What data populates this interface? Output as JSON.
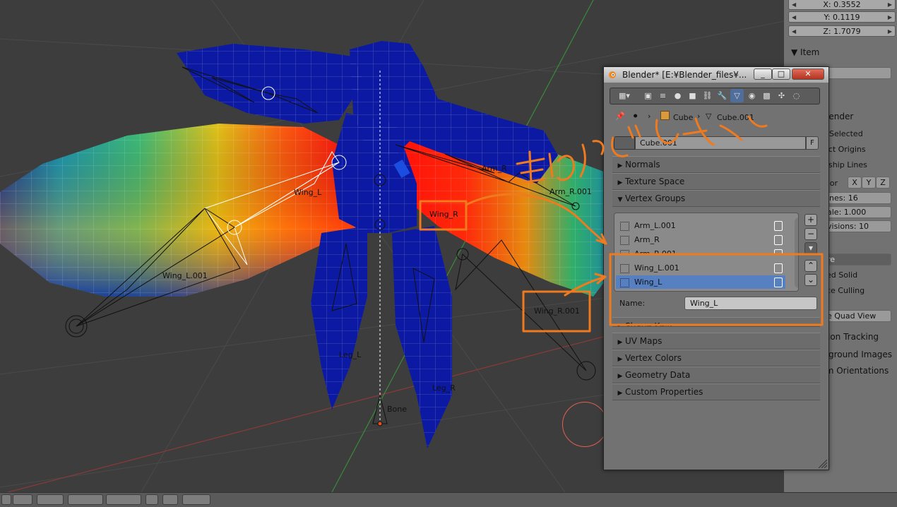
{
  "viewport": {
    "bone_labels": [
      "Wing_L",
      "Wing_L.001",
      "Wing_R",
      "Wing_R.001",
      "Arm_R",
      "Arm_R.001",
      "Bone",
      "Leg_L",
      "Leg_R"
    ]
  },
  "npanel": {
    "location": {
      "x": "X: 0.3552",
      "y": "Y: 0.1119",
      "z": "Z: 1.7079"
    },
    "item_header": "Item",
    "partial_rows": {
      "item_field": "e",
      "blender": "lender",
      "only_selected": "Selected",
      "object_origins": "ect Origins",
      "relationship_lines": "nship Lines",
      "floor": "oor",
      "axis_x": "X",
      "axis_y": "Y",
      "axis_z": "Z",
      "lines": "ines: 16",
      "scale": "ale: 1.000",
      "subdivisions": "visions: 10",
      "shading_select": "re",
      "textured_solid": "ed Solid",
      "backface_culling": "ce Culling",
      "quad_view": "e Quad View",
      "motion_tracking": "ion Tracking",
      "background_images": "kground Images",
      "transform_orientations": "rm Orientations"
    }
  },
  "window": {
    "title": "Blender* [E:¥Blender_files¥...",
    "minimize": "_",
    "maximize": "□",
    "close": "✕",
    "breadcrumb": {
      "object": "Cube",
      "mesh": "Cube.001"
    },
    "mesh_name": "Cube.001",
    "fake_user": "F",
    "panels": {
      "normals": "Normals",
      "texture_space": "Texture Space",
      "vertex_groups": "Vertex Groups",
      "shape_keys": "Shape Keys",
      "uv_maps": "UV Maps",
      "vertex_colors": "Vertex Colors",
      "geometry_data": "Geometry Data",
      "custom_properties": "Custom Properties"
    },
    "vertex_groups": [
      "Arm_L.001",
      "Arm_R",
      "Arm_R.001",
      "Wing_L.001",
      "Wing_L"
    ],
    "selected_group": "Wing_L",
    "name_label": "Name:",
    "name_value": "Wing_L"
  },
  "annotation": {
    "handwritten_text": "頂点グループがない",
    "color": "#f07a1e"
  },
  "colors": {
    "selection_blue": "#5680c2",
    "annotation_orange": "#f07a1e",
    "mesh_blue": "#0c1aa3"
  }
}
